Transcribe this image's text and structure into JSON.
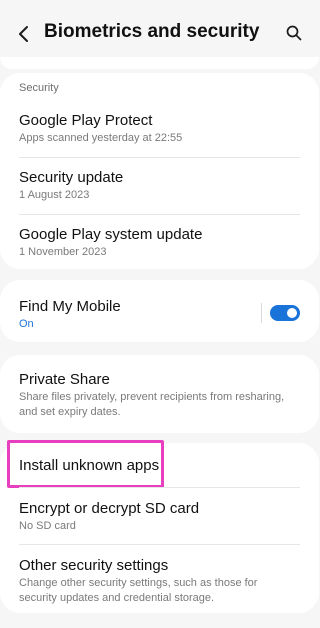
{
  "header": {
    "title": "Biometrics and security",
    "back_icon": "chevron-left-icon",
    "search_icon": "search-icon"
  },
  "security": {
    "section_label": "Security",
    "items": [
      {
        "title": "Google Play Protect",
        "subtitle": "Apps scanned yesterday at 22:55"
      },
      {
        "title": "Security update",
        "subtitle": "1 August 2023"
      },
      {
        "title": "Google Play system update",
        "subtitle": "1 November 2023"
      }
    ]
  },
  "find_my_mobile": {
    "title": "Find My Mobile",
    "status": "On",
    "enabled": true,
    "accent": "#1a73d9"
  },
  "private_share": {
    "title": "Private Share",
    "subtitle": "Share files privately, prevent recipients from resharing, and set expiry dates."
  },
  "other": {
    "items": [
      {
        "title": "Install unknown apps"
      },
      {
        "title": "Encrypt or decrypt SD card",
        "subtitle": "No SD card"
      },
      {
        "title": "Other security settings",
        "subtitle": "Change other security settings, such as those for security updates and credential storage."
      }
    ],
    "highlight_color": "#e83fbf"
  }
}
